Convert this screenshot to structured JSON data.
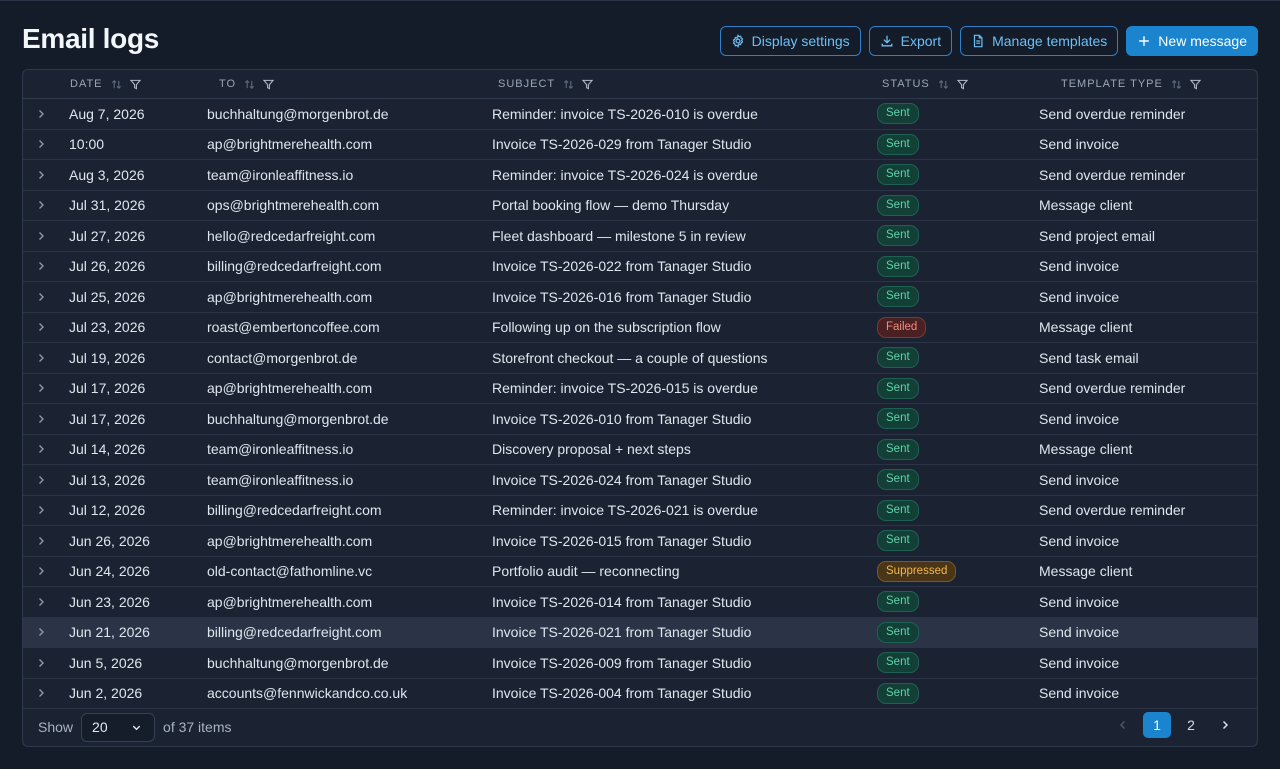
{
  "page": {
    "title": "Email logs"
  },
  "toolbar": {
    "display_settings": "Display settings",
    "export": "Export",
    "manage_templates": "Manage templates",
    "new_message": "New message"
  },
  "columns": {
    "date": "DATE",
    "to": "TO",
    "subject": "SUBJECT",
    "status": "STATUS",
    "template_type": "TEMPLATE TYPE"
  },
  "rows": [
    {
      "date": "Aug 7, 2026",
      "to": "buchhaltung@morgenbrot.de",
      "subject": "Reminder: invoice TS-2026-010 is overdue",
      "status": "Sent",
      "type": "Send overdue reminder"
    },
    {
      "date": "10:00",
      "to": "ap@brightmerehealth.com",
      "subject": "Invoice TS-2026-029 from Tanager Studio",
      "status": "Sent",
      "type": "Send invoice"
    },
    {
      "date": "Aug 3, 2026",
      "to": "team@ironleaffitness.io",
      "subject": "Reminder: invoice TS-2026-024 is overdue",
      "status": "Sent",
      "type": "Send overdue reminder"
    },
    {
      "date": "Jul 31, 2026",
      "to": "ops@brightmerehealth.com",
      "subject": "Portal booking flow — demo Thursday",
      "status": "Sent",
      "type": "Message client"
    },
    {
      "date": "Jul 27, 2026",
      "to": "hello@redcedarfreight.com",
      "subject": "Fleet dashboard — milestone 5 in review",
      "status": "Sent",
      "type": "Send project email"
    },
    {
      "date": "Jul 26, 2026",
      "to": "billing@redcedarfreight.com",
      "subject": "Invoice TS-2026-022 from Tanager Studio",
      "status": "Sent",
      "type": "Send invoice"
    },
    {
      "date": "Jul 25, 2026",
      "to": "ap@brightmerehealth.com",
      "subject": "Invoice TS-2026-016 from Tanager Studio",
      "status": "Sent",
      "type": "Send invoice"
    },
    {
      "date": "Jul 23, 2026",
      "to": "roast@embertoncoffee.com",
      "subject": "Following up on the subscription flow",
      "status": "Failed",
      "type": "Message client"
    },
    {
      "date": "Jul 19, 2026",
      "to": "contact@morgenbrot.de",
      "subject": "Storefront checkout — a couple of questions",
      "status": "Sent",
      "type": "Send task email"
    },
    {
      "date": "Jul 17, 2026",
      "to": "ap@brightmerehealth.com",
      "subject": "Reminder: invoice TS-2026-015 is overdue",
      "status": "Sent",
      "type": "Send overdue reminder"
    },
    {
      "date": "Jul 17, 2026",
      "to": "buchhaltung@morgenbrot.de",
      "subject": "Invoice TS-2026-010 from Tanager Studio",
      "status": "Sent",
      "type": "Send invoice"
    },
    {
      "date": "Jul 14, 2026",
      "to": "team@ironleaffitness.io",
      "subject": "Discovery proposal + next steps",
      "status": "Sent",
      "type": "Message client"
    },
    {
      "date": "Jul 13, 2026",
      "to": "team@ironleaffitness.io",
      "subject": "Invoice TS-2026-024 from Tanager Studio",
      "status": "Sent",
      "type": "Send invoice"
    },
    {
      "date": "Jul 12, 2026",
      "to": "billing@redcedarfreight.com",
      "subject": "Reminder: invoice TS-2026-021 is overdue",
      "status": "Sent",
      "type": "Send overdue reminder"
    },
    {
      "date": "Jun 26, 2026",
      "to": "ap@brightmerehealth.com",
      "subject": "Invoice TS-2026-015 from Tanager Studio",
      "status": "Sent",
      "type": "Send invoice"
    },
    {
      "date": "Jun 24, 2026",
      "to": "old-contact@fathomline.vc",
      "subject": "Portfolio audit — reconnecting",
      "status": "Suppressed",
      "type": "Message client"
    },
    {
      "date": "Jun 23, 2026",
      "to": "ap@brightmerehealth.com",
      "subject": "Invoice TS-2026-014 from Tanager Studio",
      "status": "Sent",
      "type": "Send invoice"
    },
    {
      "date": "Jun 21, 2026",
      "to": "billing@redcedarfreight.com",
      "subject": "Invoice TS-2026-021 from Tanager Studio",
      "status": "Sent",
      "type": "Send invoice",
      "highlighted": true
    },
    {
      "date": "Jun 5, 2026",
      "to": "buchhaltung@morgenbrot.de",
      "subject": "Invoice TS-2026-009 from Tanager Studio",
      "status": "Sent",
      "type": "Send invoice"
    },
    {
      "date": "Jun 2, 2026",
      "to": "accounts@fennwickandco.co.uk",
      "subject": "Invoice TS-2026-004 from Tanager Studio",
      "status": "Sent",
      "type": "Send invoice"
    }
  ],
  "footer": {
    "show_label": "Show",
    "page_size": "20",
    "items_text": "of 37 items",
    "pages": [
      "1",
      "2"
    ],
    "current_page": "1"
  },
  "colors": {
    "accent": "#1a84cf",
    "sent": "#5fd3a8",
    "failed": "#f08c7d",
    "suppressed": "#f2b84b"
  }
}
